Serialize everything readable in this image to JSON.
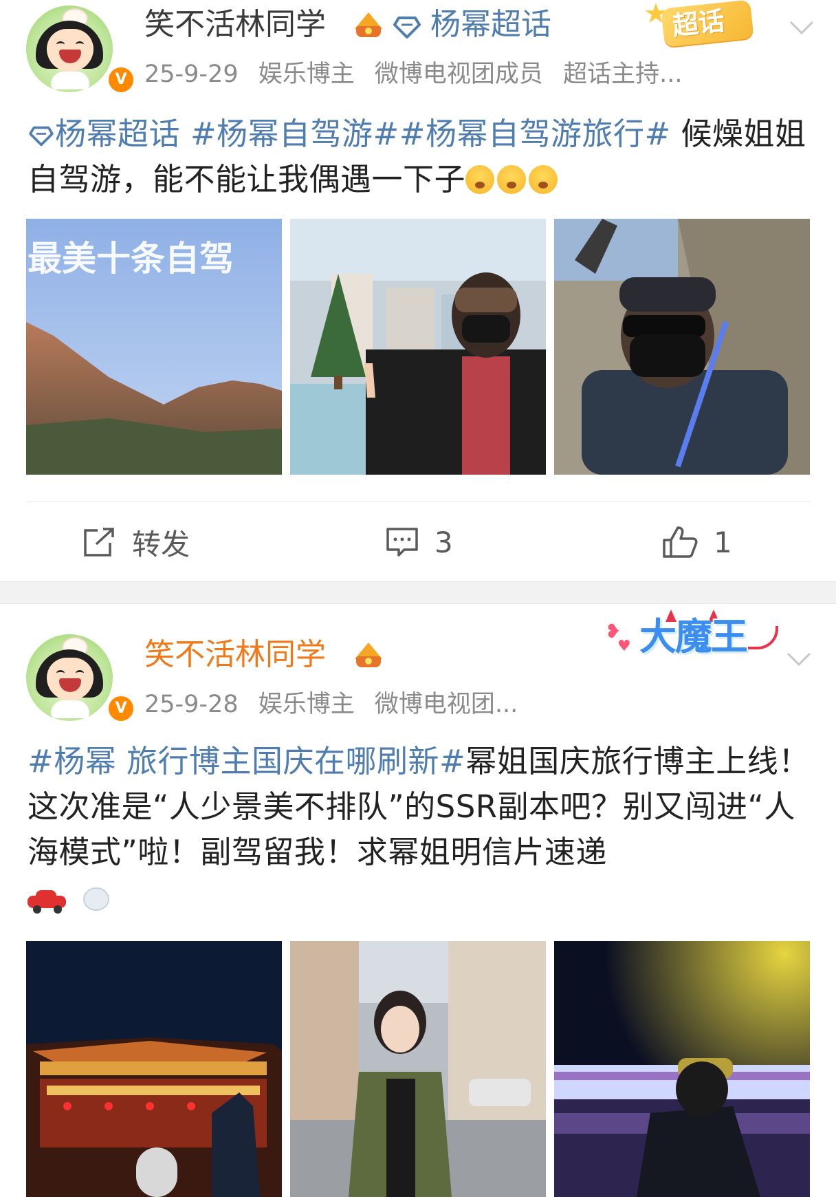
{
  "posts": [
    {
      "username": "笑不活林同学",
      "supertopic": "杨幂超话",
      "badge": "超话",
      "date": "25-9-29",
      "tags_meta": [
        "娱乐博主",
        "微博电视团成员",
        "超话主持..."
      ],
      "content": {
        "topic1": "杨幂超话",
        "tag2": "#杨幂自驾游#",
        "tag3": "#杨幂自驾游旅行#",
        "text": " 候燥姐姐自驾游，能不能让我偶遇一下子"
      },
      "images": [
        {
          "caption": "最美十条自驾"
        },
        {
          "caption": ""
        },
        {
          "caption": ""
        }
      ],
      "actions": {
        "repost": "转发",
        "comments": "3",
        "likes": "1"
      }
    },
    {
      "username": "笑不活林同学",
      "badge": "大魔王",
      "date": "25-9-28",
      "tags_meta": [
        "娱乐博主",
        "微博电视团..."
      ],
      "content": {
        "tag1": "#杨幂 旅行博主国庆在哪刷新#",
        "text": "幂姐国庆旅行博主上线！这次准是“人少景美不排队”的SSR副本吧？别又闯进“人海模式”啦！副驾留我！求幂姐明信片速递"
      }
    }
  ],
  "colors": {
    "link": "#507daf",
    "username_vip": "#f07a1a",
    "meta": "#8a8a8a",
    "text": "#222222"
  },
  "icons": [
    "chevron-down-icon",
    "diamond-icon",
    "crown-icon",
    "repost-icon",
    "comment-icon",
    "like-icon",
    "verified-icon"
  ]
}
